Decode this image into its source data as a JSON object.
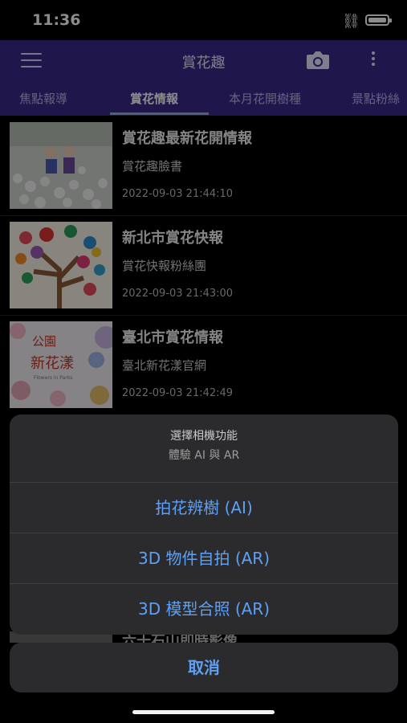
{
  "status_bar": {
    "time": "11:36"
  },
  "app_bar": {
    "title": "賞花趣"
  },
  "tabs": [
    {
      "label": "焦點報導"
    },
    {
      "label": "賞花情報",
      "active": true
    },
    {
      "label": "本月花開樹種"
    },
    {
      "label": "景點粉絲"
    }
  ],
  "list": [
    {
      "title": "賞花趣最新花開情報",
      "source": "賞花趣臉書",
      "datetime": "2022-09-03 21:44:10"
    },
    {
      "title": "新北市賞花快報",
      "source": "賞花快報粉絲團",
      "datetime": "2022-09-03 21:43:00"
    },
    {
      "title": "臺北市賞花情報",
      "source": "臺北新花漾官網",
      "datetime": "2022-09-03 21:42:49"
    },
    {
      "title": "六十石山即時影像"
    }
  ],
  "thumb3_text": {
    "line1": "公園",
    "line2": "新花漾",
    "line3": "Flowers in Parks"
  },
  "action_sheet": {
    "title": "選擇相機功能",
    "subtitle": "體驗 AI 與 AR",
    "options": [
      "拍花辨樹 (AI)",
      "3D 物件自拍 (AR)",
      "3D 模型合照 (AR)"
    ],
    "cancel": "取消"
  },
  "colors": {
    "app_bar": "#3a2b8a",
    "accent": "#5ea0f5"
  }
}
